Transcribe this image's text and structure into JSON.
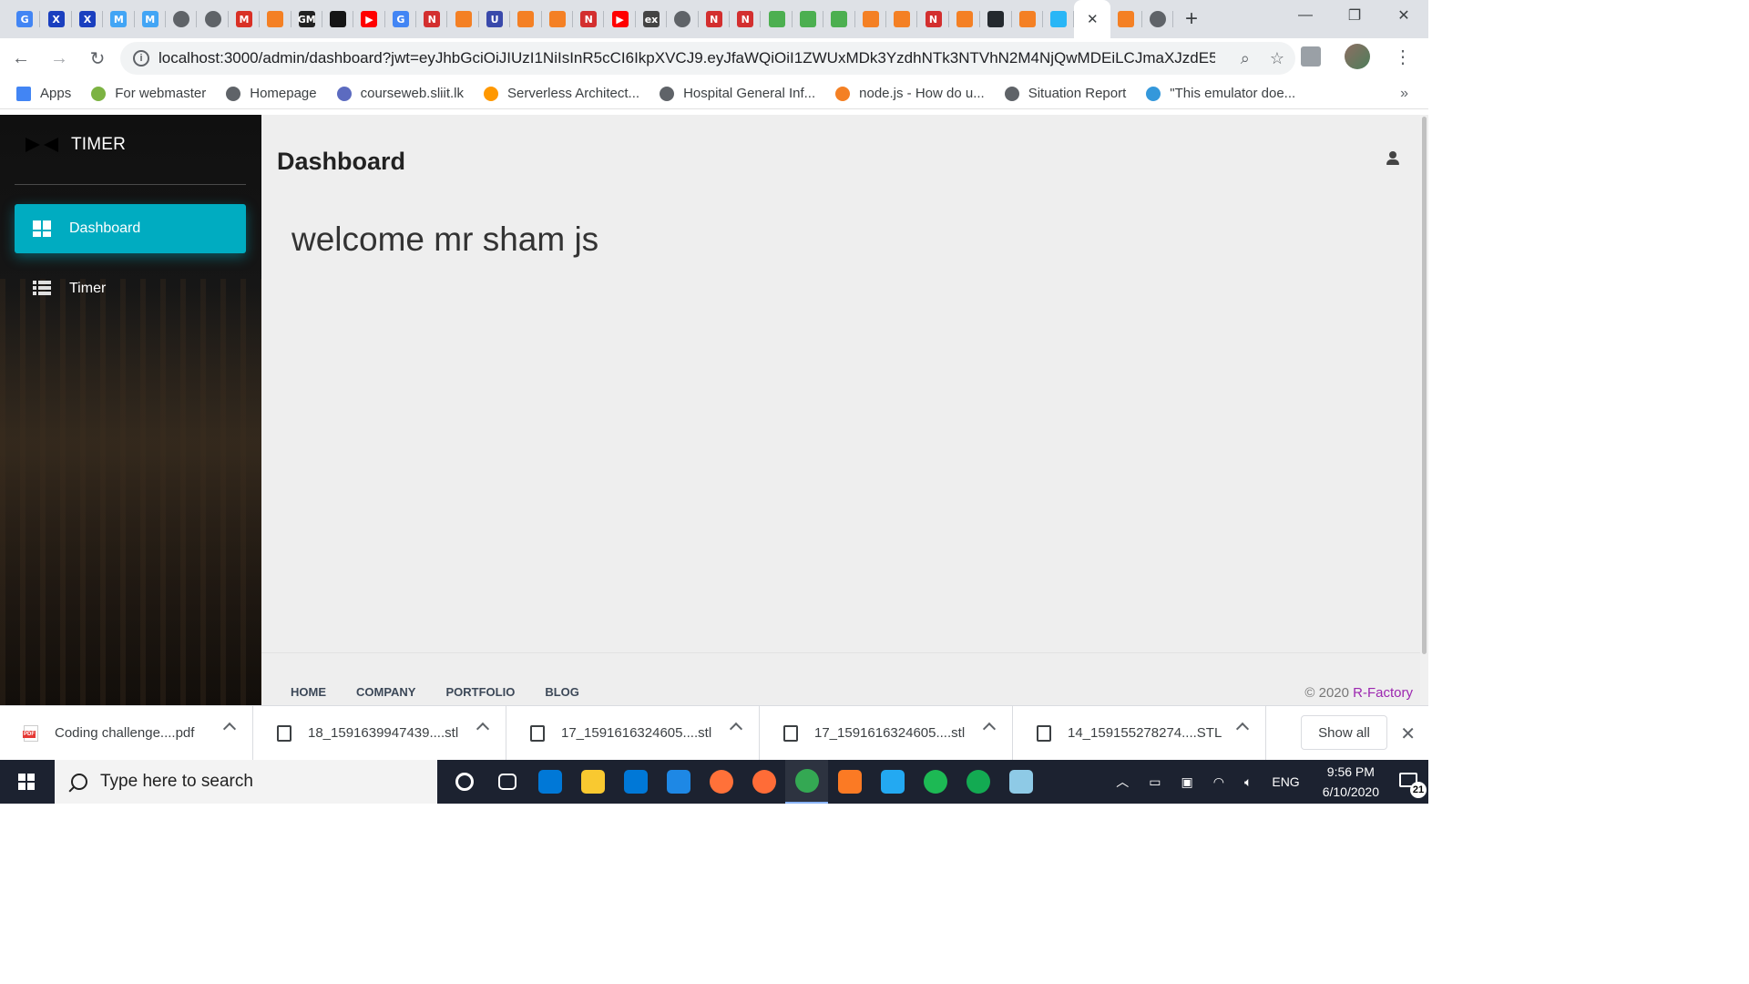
{
  "browser": {
    "tabs": [
      {
        "icon": "google-icon",
        "glyph": "G",
        "color": "#4285f4"
      },
      {
        "icon": "xmind-icon",
        "glyph": "X",
        "color": "#1a3fbf"
      },
      {
        "icon": "xmind-icon",
        "glyph": "X",
        "color": "#1a3fbf"
      },
      {
        "icon": "material-ui-icon",
        "glyph": "M",
        "color": "#42a5f5"
      },
      {
        "icon": "material-ui-icon",
        "glyph": "M",
        "color": "#42a5f5"
      },
      {
        "icon": "globe-icon",
        "glyph": "",
        "color": "#5f6368"
      },
      {
        "icon": "globe-icon",
        "glyph": "",
        "color": "#5f6368"
      },
      {
        "icon": "gmail-icon",
        "glyph": "M",
        "color": "#d93025"
      },
      {
        "icon": "stackoverflow-icon",
        "glyph": "",
        "color": "#f48024"
      },
      {
        "icon": "gm-icon",
        "glyph": "GM",
        "color": "#222222"
      },
      {
        "icon": "codesandbox-icon",
        "glyph": "",
        "color": "#151515"
      },
      {
        "icon": "youtube-icon",
        "glyph": "▶",
        "color": "#ff0000"
      },
      {
        "icon": "google-icon",
        "glyph": "G",
        "color": "#4285f4"
      },
      {
        "icon": "notion-icon",
        "glyph": "N",
        "color": "#d32f2f"
      },
      {
        "icon": "stackoverflow-icon",
        "glyph": "",
        "color": "#f48024"
      },
      {
        "icon": "udemy-icon",
        "glyph": "U",
        "color": "#3949ab"
      },
      {
        "icon": "stackoverflow-icon",
        "glyph": "",
        "color": "#f48024"
      },
      {
        "icon": "stackoverflow-icon",
        "glyph": "",
        "color": "#f48024"
      },
      {
        "icon": "notion-icon",
        "glyph": "N",
        "color": "#d32f2f"
      },
      {
        "icon": "youtube-icon",
        "glyph": "▶",
        "color": "#ff0000"
      },
      {
        "icon": "express-icon",
        "glyph": "ex",
        "color": "#444444"
      },
      {
        "icon": "globe-icon",
        "glyph": "",
        "color": "#5f6368"
      },
      {
        "icon": "notion-icon",
        "glyph": "N",
        "color": "#d32f2f"
      },
      {
        "icon": "notion-icon",
        "glyph": "N",
        "color": "#d32f2f"
      },
      {
        "icon": "mongodb-icon",
        "glyph": "",
        "color": "#4caf50"
      },
      {
        "icon": "mongodb-icon",
        "glyph": "",
        "color": "#4caf50"
      },
      {
        "icon": "mongodb-icon",
        "glyph": "",
        "color": "#4caf50"
      },
      {
        "icon": "stackoverflow-icon",
        "glyph": "",
        "color": "#f48024"
      },
      {
        "icon": "stackoverflow-icon",
        "glyph": "",
        "color": "#f48024"
      },
      {
        "icon": "notion-icon",
        "glyph": "N",
        "color": "#d32f2f"
      },
      {
        "icon": "stackoverflow-icon",
        "glyph": "",
        "color": "#f48024"
      },
      {
        "icon": "github-icon",
        "glyph": "",
        "color": "#24292e"
      },
      {
        "icon": "stackoverflow-icon",
        "glyph": "",
        "color": "#f48024"
      },
      {
        "icon": "bird-icon",
        "glyph": "",
        "color": "#29b6f6"
      }
    ],
    "after_tabs": [
      {
        "icon": "stackoverflow-icon",
        "color": "#f48024"
      },
      {
        "icon": "globe-icon",
        "color": "#5f6368"
      }
    ],
    "url": "localhost:3000/admin/dashboard?jwt=eyJhbGciOiJIUzI1NiIsInR5cCI6IkpXVCJ9.eyJfaWQiOiI1ZWUxMDk3YzdhNTk3NTVhN2M4NjQwMDEiLCJmaXJzdE5h...",
    "bookmarks": [
      {
        "label": "Apps",
        "icon": "apps-icon",
        "color": "#4285f4"
      },
      {
        "label": "For webmaster",
        "icon": "webmaster-icon",
        "color": "#7cb342"
      },
      {
        "label": "Homepage",
        "icon": "globe-icon",
        "color": "#5f6368"
      },
      {
        "label": "courseweb.sliit.lk",
        "icon": "sliit-icon",
        "color": "#5c6bc0"
      },
      {
        "label": "Serverless Architect...",
        "icon": "aws-icon",
        "color": "#ff9800"
      },
      {
        "label": "Hospital General Inf...",
        "icon": "globe-icon",
        "color": "#5f6368"
      },
      {
        "label": "node.js - How do u...",
        "icon": "stackoverflow-icon",
        "color": "#f48024"
      },
      {
        "label": "Situation Report",
        "icon": "globe-icon",
        "color": "#5f6368"
      },
      {
        "label": "\"This emulator doe...",
        "icon": "xamarin-icon",
        "color": "#3498db"
      }
    ]
  },
  "app": {
    "brand": "TIMER",
    "nav": [
      {
        "label": "Dashboard",
        "active": true
      },
      {
        "label": "Timer",
        "active": false
      }
    ],
    "page_title": "Dashboard",
    "welcome": "welcome mr sham js",
    "footer_links": [
      "HOME",
      "COMPANY",
      "PORTFOLIO",
      "BLOG"
    ],
    "copyright_prefix": "© 2020 ",
    "copyright_brand": "R-Factory",
    "accent": "#00acc1"
  },
  "downloads": {
    "items": [
      {
        "name": "Coding challenge....pdf",
        "type": "pdf"
      },
      {
        "name": "18_1591639947439....stl",
        "type": "stl"
      },
      {
        "name": "17_1591616324605....stl",
        "type": "stl"
      },
      {
        "name": "17_1591616324605....stl",
        "type": "stl"
      },
      {
        "name": "14_159155278274....STL",
        "type": "stl"
      }
    ],
    "show_all": "Show all"
  },
  "taskbar": {
    "search_placeholder": "Type here to search",
    "apps": [
      {
        "icon": "cortana-icon",
        "color": "#ffffff"
      },
      {
        "icon": "task-view-icon",
        "color": "#ffffff"
      },
      {
        "icon": "edge-icon",
        "color": "#0078d7"
      },
      {
        "icon": "file-explorer-icon",
        "color": "#f9c930"
      },
      {
        "icon": "store-icon",
        "color": "#0078d7"
      },
      {
        "icon": "mail-icon",
        "color": "#1e88e5"
      },
      {
        "icon": "firefox-icon",
        "color": "#ff7139"
      },
      {
        "icon": "postman-icon",
        "color": "#ff6c37"
      },
      {
        "icon": "chrome-icon",
        "color": "#34a853"
      },
      {
        "icon": "xampp-icon",
        "color": "#fb7a24"
      },
      {
        "icon": "vscode-icon",
        "color": "#23a9f2"
      },
      {
        "icon": "spotify-icon",
        "color": "#1db954"
      },
      {
        "icon": "mongodb-compass-icon",
        "color": "#13aa52"
      },
      {
        "icon": "notepad-icon",
        "color": "#8ecae6"
      }
    ],
    "language": "ENG",
    "time": "9:56 PM",
    "date": "6/10/2020",
    "notifications": "21"
  }
}
